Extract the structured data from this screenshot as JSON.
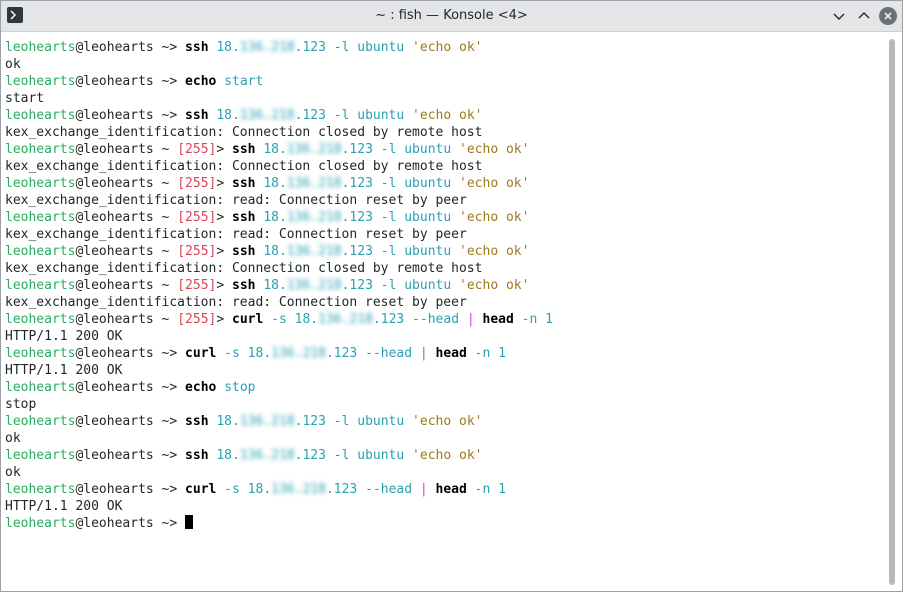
{
  "window": {
    "title": "~ : fish — Konsole <4>"
  },
  "colors": {
    "user": "#27ae60",
    "status": "#da4453",
    "arg": "#2aa1b3",
    "string": "#9c7a1d",
    "pipe": "#c84cc7"
  },
  "terminal": {
    "lines": [
      {
        "type": "prompt",
        "user": "leohearts",
        "host": "@leohearts",
        "path": " ~",
        "status": "",
        "sym": ">",
        "cmd": "ssh",
        "args": [
          {
            "t": "arg",
            "v": "18."
          },
          {
            "t": "blur",
            "v": "136.218"
          },
          {
            "t": "arg",
            "v": ".123 -l ubuntu "
          },
          {
            "t": "str",
            "v": "'echo ok'"
          }
        ]
      },
      {
        "type": "out",
        "text": "ok"
      },
      {
        "type": "prompt",
        "user": "leohearts",
        "host": "@leohearts",
        "path": " ~",
        "status": "",
        "sym": ">",
        "cmd": "echo",
        "args": [
          {
            "t": "arg",
            "v": "start"
          }
        ]
      },
      {
        "type": "out",
        "text": "start"
      },
      {
        "type": "prompt",
        "user": "leohearts",
        "host": "@leohearts",
        "path": " ~",
        "status": "",
        "sym": ">",
        "cmd": "ssh",
        "args": [
          {
            "t": "arg",
            "v": "18."
          },
          {
            "t": "blur",
            "v": "136.218"
          },
          {
            "t": "arg",
            "v": ".123 -l ubuntu "
          },
          {
            "t": "str",
            "v": "'echo ok'"
          }
        ]
      },
      {
        "type": "out",
        "text": "kex_exchange_identification: Connection closed by remote host"
      },
      {
        "type": "prompt",
        "user": "leohearts",
        "host": "@leohearts",
        "path": " ~",
        "status": "[255]",
        "sym": ">",
        "cmd": "ssh",
        "args": [
          {
            "t": "arg",
            "v": "18."
          },
          {
            "t": "blur",
            "v": "136.218"
          },
          {
            "t": "arg",
            "v": ".123 -l ubuntu "
          },
          {
            "t": "str",
            "v": "'echo ok'"
          }
        ]
      },
      {
        "type": "out",
        "text": "kex_exchange_identification: Connection closed by remote host"
      },
      {
        "type": "prompt",
        "user": "leohearts",
        "host": "@leohearts",
        "path": " ~",
        "status": "[255]",
        "sym": ">",
        "cmd": "ssh",
        "args": [
          {
            "t": "arg",
            "v": "18."
          },
          {
            "t": "blur",
            "v": "136.218"
          },
          {
            "t": "arg",
            "v": ".123 -l ubuntu "
          },
          {
            "t": "str",
            "v": "'echo ok'"
          }
        ]
      },
      {
        "type": "out",
        "text": "kex_exchange_identification: read: Connection reset by peer"
      },
      {
        "type": "prompt",
        "user": "leohearts",
        "host": "@leohearts",
        "path": " ~",
        "status": "[255]",
        "sym": ">",
        "cmd": "ssh",
        "args": [
          {
            "t": "arg",
            "v": "18."
          },
          {
            "t": "blur",
            "v": "136.218"
          },
          {
            "t": "arg",
            "v": ".123 -l ubuntu "
          },
          {
            "t": "str",
            "v": "'echo ok'"
          }
        ]
      },
      {
        "type": "out",
        "text": "kex_exchange_identification: read: Connection reset by peer"
      },
      {
        "type": "prompt",
        "user": "leohearts",
        "host": "@leohearts",
        "path": " ~",
        "status": "[255]",
        "sym": ">",
        "cmd": "ssh",
        "args": [
          {
            "t": "arg",
            "v": "18."
          },
          {
            "t": "blur",
            "v": "136.218"
          },
          {
            "t": "arg",
            "v": ".123 -l ubuntu "
          },
          {
            "t": "str",
            "v": "'echo ok'"
          }
        ]
      },
      {
        "type": "out",
        "text": "kex_exchange_identification: Connection closed by remote host"
      },
      {
        "type": "prompt",
        "user": "leohearts",
        "host": "@leohearts",
        "path": " ~",
        "status": "[255]",
        "sym": ">",
        "cmd": "ssh",
        "args": [
          {
            "t": "arg",
            "v": "18."
          },
          {
            "t": "blur",
            "v": "136.218"
          },
          {
            "t": "arg",
            "v": ".123 -l ubuntu "
          },
          {
            "t": "str",
            "v": "'echo ok'"
          }
        ]
      },
      {
        "type": "out",
        "text": "kex_exchange_identification: read: Connection reset by peer"
      },
      {
        "type": "prompt",
        "user": "leohearts",
        "host": "@leohearts",
        "path": " ~",
        "status": "[255]",
        "sym": ">",
        "cmd": "curl",
        "args": [
          {
            "t": "arg",
            "v": "-s 18."
          },
          {
            "t": "blur",
            "v": "136.218"
          },
          {
            "t": "arg",
            "v": ".123 --head "
          },
          {
            "t": "pipe",
            "v": "| "
          },
          {
            "t": "cmd",
            "v": "head"
          },
          {
            "t": "arg",
            "v": " -n 1"
          }
        ]
      },
      {
        "type": "out",
        "text": "HTTP/1.1 200 OK"
      },
      {
        "type": "prompt",
        "user": "leohearts",
        "host": "@leohearts",
        "path": " ~",
        "status": "",
        "sym": ">",
        "cmd": "curl",
        "args": [
          {
            "t": "arg",
            "v": "-s 18."
          },
          {
            "t": "blur",
            "v": "136.218"
          },
          {
            "t": "arg",
            "v": ".123 --head "
          },
          {
            "t": "pipe",
            "v": "| "
          },
          {
            "t": "cmd",
            "v": "head"
          },
          {
            "t": "arg",
            "v": " -n 1"
          }
        ]
      },
      {
        "type": "out",
        "text": "HTTP/1.1 200 OK"
      },
      {
        "type": "prompt",
        "user": "leohearts",
        "host": "@leohearts",
        "path": " ~",
        "status": "",
        "sym": ">",
        "cmd": "echo",
        "args": [
          {
            "t": "arg",
            "v": "stop"
          }
        ]
      },
      {
        "type": "out",
        "text": "stop"
      },
      {
        "type": "prompt",
        "user": "leohearts",
        "host": "@leohearts",
        "path": " ~",
        "status": "",
        "sym": ">",
        "cmd": "ssh",
        "args": [
          {
            "t": "arg",
            "v": "18."
          },
          {
            "t": "blur",
            "v": "136.218"
          },
          {
            "t": "arg",
            "v": ".123 -l ubuntu "
          },
          {
            "t": "str",
            "v": "'echo ok'"
          }
        ]
      },
      {
        "type": "out",
        "text": "ok"
      },
      {
        "type": "prompt",
        "user": "leohearts",
        "host": "@leohearts",
        "path": " ~",
        "status": "",
        "sym": ">",
        "cmd": "ssh",
        "args": [
          {
            "t": "arg",
            "v": "18."
          },
          {
            "t": "blur",
            "v": "136.218"
          },
          {
            "t": "arg",
            "v": ".123 -l ubuntu "
          },
          {
            "t": "str",
            "v": "'echo ok'"
          }
        ]
      },
      {
        "type": "out",
        "text": "ok"
      },
      {
        "type": "prompt",
        "user": "leohearts",
        "host": "@leohearts",
        "path": " ~",
        "status": "",
        "sym": ">",
        "cmd": "curl",
        "args": [
          {
            "t": "arg",
            "v": "-s 18."
          },
          {
            "t": "blur",
            "v": "136.218"
          },
          {
            "t": "arg",
            "v": ".123 --head "
          },
          {
            "t": "pipe",
            "v": "| "
          },
          {
            "t": "cmd",
            "v": "head"
          },
          {
            "t": "arg",
            "v": " -n 1"
          }
        ]
      },
      {
        "type": "out",
        "text": "HTTP/1.1 200 OK"
      },
      {
        "type": "prompt",
        "user": "leohearts",
        "host": "@leohearts",
        "path": " ~",
        "status": "",
        "sym": ">",
        "cmd": "",
        "args": [],
        "cursor": true
      }
    ]
  }
}
